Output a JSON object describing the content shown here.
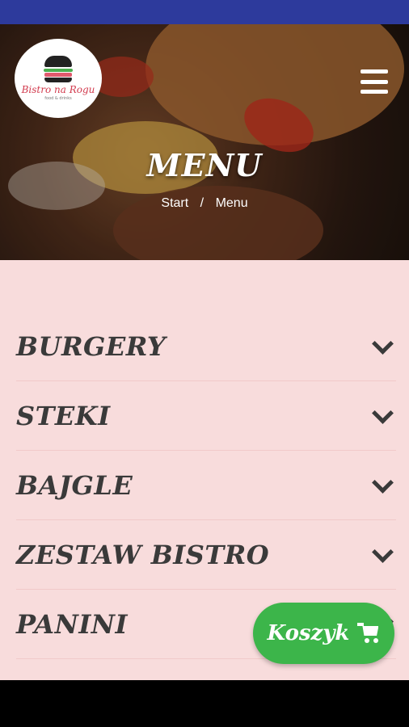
{
  "header": {
    "logo": {
      "name": "Bistro na Rogu",
      "tagline": "food & drinks",
      "icon": "burger-icon"
    },
    "menu_icon": "hamburger-menu-icon",
    "title": "MENU",
    "breadcrumb": {
      "home": "Start",
      "separator": "/",
      "current": "Menu"
    }
  },
  "menu": {
    "categories": [
      {
        "label": "BURGERY",
        "icon": "chevron-down-icon"
      },
      {
        "label": "STEKI",
        "icon": "chevron-down-icon"
      },
      {
        "label": "BAJGLE",
        "icon": "chevron-down-icon"
      },
      {
        "label": "ZESTAW BISTRO",
        "icon": "chevron-down-icon"
      },
      {
        "label": "PANINI",
        "icon": "chevron-down-icon"
      }
    ]
  },
  "cart": {
    "label": "Koszyk",
    "icon": "cart-icon"
  },
  "colors": {
    "status_bar": "#2d3a9c",
    "content_bg": "#f8dcdc",
    "cart_button": "#3cb54a",
    "text_dark": "#3a3a3a",
    "logo_accent": "#d23b4e"
  }
}
